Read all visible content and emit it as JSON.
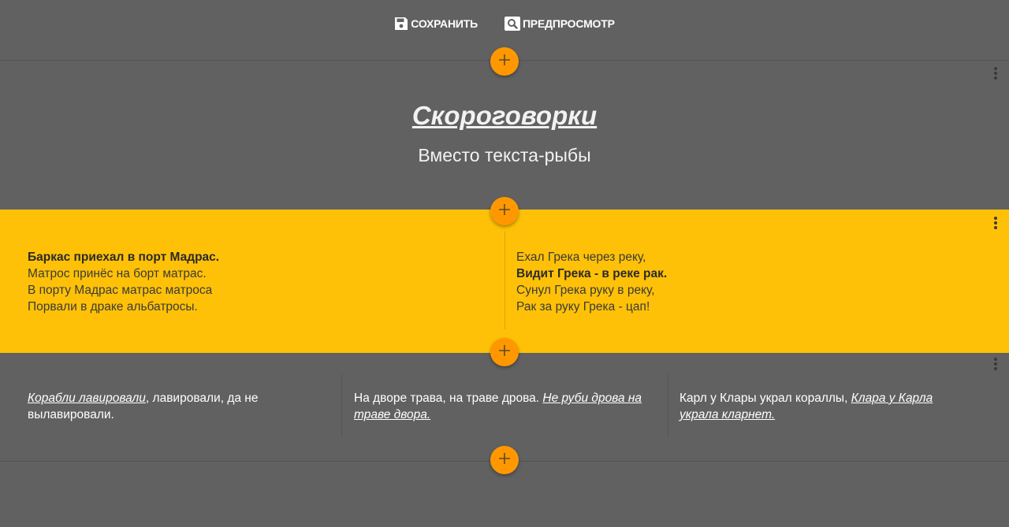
{
  "toolbar": {
    "save_label": "СОХРАНИТЬ",
    "preview_label": "ПРЕДПРОСМОТР"
  },
  "header_section": {
    "title": "Скороговорки",
    "subtitle": "Вместо текста-рыбы"
  },
  "yellow_section": {
    "left_poem": [
      {
        "text": "Баркас приехал в порт Мадрас.",
        "bold": true
      },
      {
        "text": "Матрос принёс на борт матрас.",
        "bold": false
      },
      {
        "text": "В порту Мадрас матрас матроса",
        "bold": false
      },
      {
        "text": "Порвали в драке альбатросы.",
        "bold": false
      }
    ],
    "right_poem": [
      {
        "text": "Ехал Грека через реку,",
        "bold": false
      },
      {
        "text": "Видит Грека - в реке рак.",
        "bold": true
      },
      {
        "text": "Сунул Грека руку в реку,",
        "bold": false
      },
      {
        "text": "Рак за руку Грека - цап!",
        "bold": false
      }
    ]
  },
  "three_col_section": {
    "col1": {
      "em": "Корабли лавировали",
      "rest": ", лавировали, да не вылавировали."
    },
    "col2": {
      "plain": "На дворе трава, на траве дрова. ",
      "em": "Не руби дрова на траве двора."
    },
    "col3": {
      "plain": "Карл у Клары украл кораллы, ",
      "em": "Клара у Карла украла кларнет."
    }
  },
  "colors": {
    "background": "#616161",
    "accent_yellow": "#ffc107",
    "fab_orange": "#ff9800",
    "text_light": "#ffffff",
    "text_dark": "#3a3a3a"
  },
  "icons": {
    "save": "floppy-disk-icon",
    "preview": "search-icon",
    "add": "plus-icon",
    "more": "more-vert-icon"
  }
}
